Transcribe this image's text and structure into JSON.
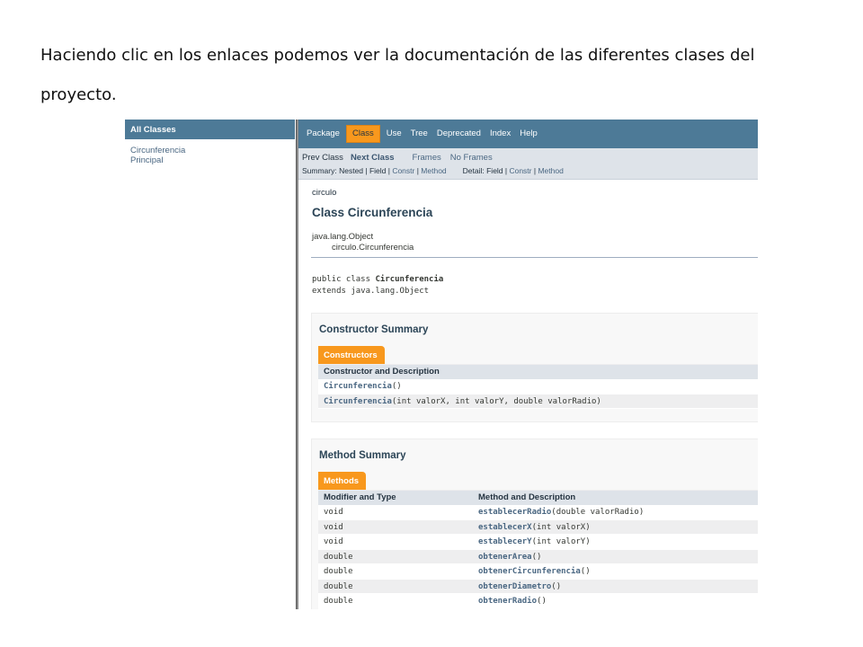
{
  "caption": "Haciendo clic en los enlaces podemos ver la documentación de las diferentes clases del proyecto.",
  "left_frame": {
    "header": "All Classes",
    "classes": [
      "Circunferencia",
      "Principal"
    ]
  },
  "top_nav": {
    "items": [
      "Package",
      "Class",
      "Use",
      "Tree",
      "Deprecated",
      "Index",
      "Help"
    ],
    "active": "Class"
  },
  "sub_nav": {
    "prev": "Prev Class",
    "next": "Next Class",
    "frames": "Frames",
    "no_frames": "No Frames",
    "summary_prefix": "Summary: Nested | Field | ",
    "summary_constr": "Constr",
    "summary_sep": " | ",
    "summary_method": "Method",
    "detail_prefix": "Detail: Field | ",
    "detail_constr": "Constr",
    "detail_sep": " | ",
    "detail_method": "Method"
  },
  "header": {
    "package": "circulo",
    "title": "Class Circunferencia",
    "inherit_root": "java.lang.Object",
    "inherit_child": "circulo.Circunferencia"
  },
  "declaration": {
    "line1_prefix": "public class ",
    "line1_name": "Circunferencia",
    "line2": "extends java.lang.Object"
  },
  "constructor_summary": {
    "title": "Constructor Summary",
    "tab": "Constructors",
    "header": "Constructor and Description",
    "rows": [
      {
        "name": "Circunferencia",
        "params": "()"
      },
      {
        "name": "Circunferencia",
        "params": "(int valorX, int valorY, double valorRadio)"
      }
    ]
  },
  "method_summary": {
    "title": "Method Summary",
    "tab": "Methods",
    "header_type": "Modifier and Type",
    "header_desc": "Method and Description",
    "rows": [
      {
        "type": "void",
        "name": "establecerRadio",
        "params": "(double valorRadio)"
      },
      {
        "type": "void",
        "name": "establecerX",
        "params": "(int valorX)"
      },
      {
        "type": "void",
        "name": "establecerY",
        "params": "(int valorY)"
      },
      {
        "type": "double",
        "name": "obtenerArea",
        "params": "()"
      },
      {
        "type": "double",
        "name": "obtenerCircunferencia",
        "params": "()"
      },
      {
        "type": "double",
        "name": "obtenerDiametro",
        "params": "()"
      },
      {
        "type": "double",
        "name": "obtenerRadio",
        "params": "()"
      }
    ]
  }
}
